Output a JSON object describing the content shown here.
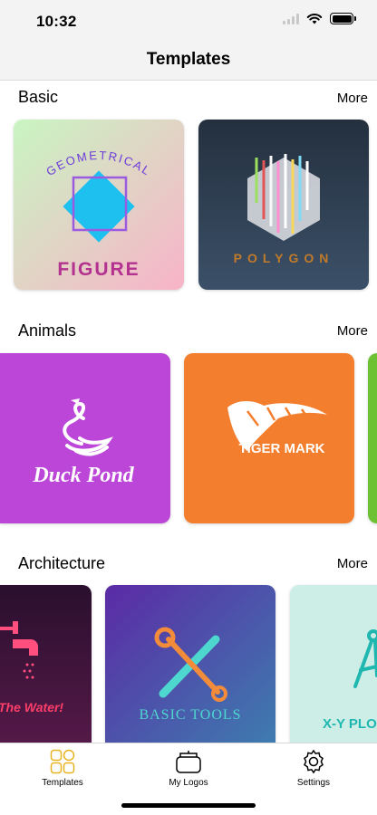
{
  "status_bar": {
    "time": "10:32"
  },
  "nav": {
    "title": "Templates"
  },
  "sections": [
    {
      "title": "Basic",
      "more": "More",
      "cards": [
        {
          "name": "Geometrical Figure",
          "line1": "GEOMETRICAL",
          "line2": "FIGURE"
        },
        {
          "name": "Polygon",
          "text": "POLYGON"
        }
      ]
    },
    {
      "title": "Animals",
      "more": "More",
      "cards": [
        {
          "name": "Duck Pond",
          "text": "Duck Pond"
        },
        {
          "name": "Tiger Mark",
          "text": "TIGER MARK"
        }
      ]
    },
    {
      "title": "Architecture",
      "more": "More",
      "cards": [
        {
          "name": "The Water",
          "text": "The Water!"
        },
        {
          "name": "Basic Tools",
          "text": "BASIC TOOLS"
        },
        {
          "name": "X-Y Plot",
          "text": "X-Y PLO"
        }
      ]
    }
  ],
  "tabbar": {
    "tabs": [
      {
        "label": "Templates",
        "icon": "templates-grid-icon",
        "active": true
      },
      {
        "label": "My Logos",
        "icon": "box-icon",
        "active": false
      },
      {
        "label": "Settings",
        "icon": "gear-icon",
        "active": false
      }
    ]
  },
  "colors": {
    "accent": "#e8b320"
  }
}
